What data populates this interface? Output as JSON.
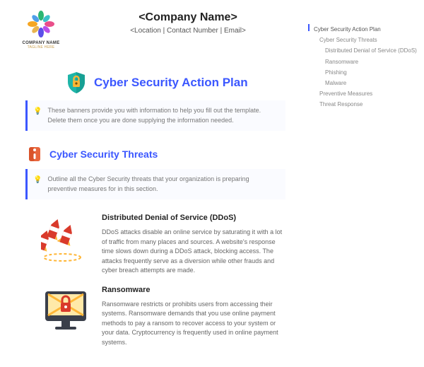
{
  "header": {
    "company": "<Company Name>",
    "meta": "<Location | Contact Number | Email>",
    "logo_text": "COMPANY NAME",
    "logo_tagline": "TAGLINE HERE"
  },
  "title": "Cyber Security Action Plan",
  "banner1": "These banners provide you with information to help you fill out the template. Delete them once you are done supplying the information needed.",
  "threats_title": "Cyber Security Threats",
  "banner2": "Outline all the Cyber Security threats that your organization is preparing preventive measures for in this section.",
  "threats": [
    {
      "title": "Distributed Denial of Service (DDoS)",
      "body": "DDoS attacks disable an online service by saturating it with a lot of traffic from many places and sources. A website's response time slows down during a DDoS attack, blocking access. The attacks frequently serve as a diversion while other frauds and cyber breach attempts are made."
    },
    {
      "title": "Ransomware",
      "body": "Ransomware restricts or prohibits users from accessing their systems. Ransomware demands that you use online payment methods to pay a ransom to recover access to your system or your data. Cryptocurrency is frequently used in online payment systems."
    }
  ],
  "toc": [
    {
      "label": "Cyber Security Action Plan",
      "lvl": 0
    },
    {
      "label": "Cyber Security Threats",
      "lvl": 1
    },
    {
      "label": "Distributed Denial of Service (DDoS)",
      "lvl": 2
    },
    {
      "label": "Ransomware",
      "lvl": 2
    },
    {
      "label": "Phishing",
      "lvl": 2
    },
    {
      "label": "Malware",
      "lvl": 2
    },
    {
      "label": "Preventive Measures",
      "lvl": 1
    },
    {
      "label": "Threat Response",
      "lvl": 1
    }
  ]
}
